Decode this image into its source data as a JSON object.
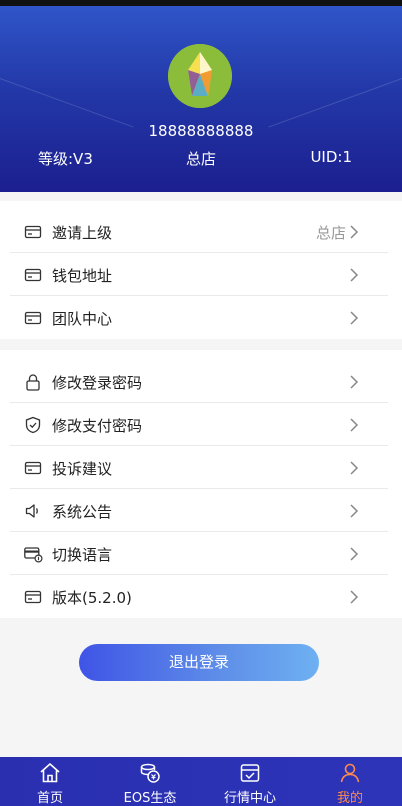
{
  "profile": {
    "phone": "18888888888",
    "level": "等级:V3",
    "store": "总店",
    "uid": "UID:1"
  },
  "menu_group_1": [
    {
      "label": "邀请上级",
      "value": "总店",
      "icon": "card-icon"
    },
    {
      "label": "钱包地址",
      "value": "",
      "icon": "card-icon"
    },
    {
      "label": "团队中心",
      "value": "",
      "icon": "card-icon"
    }
  ],
  "menu_group_2": [
    {
      "label": "修改登录密码",
      "icon": "lock-icon"
    },
    {
      "label": "修改支付密码",
      "icon": "shield-icon"
    },
    {
      "label": "投诉建议",
      "icon": "card-icon"
    },
    {
      "label": "系统公告",
      "icon": "speaker-icon"
    },
    {
      "label": "切换语言",
      "icon": "language-card-icon"
    },
    {
      "label": "版本(5.2.0)",
      "icon": "card-icon"
    }
  ],
  "logout_label": "退出登录",
  "tabbar": [
    {
      "label": "首页",
      "icon": "home-icon"
    },
    {
      "label": "EOS生态",
      "icon": "coins-icon"
    },
    {
      "label": "行情中心",
      "icon": "market-box-icon"
    },
    {
      "label": "我的",
      "icon": "user-icon"
    }
  ],
  "colors": {
    "header_top": "#2f55c8",
    "header_bottom": "#1c1f8f",
    "active_tab": "#ff8a4c",
    "tabbar_bg": "#2a2fb0"
  }
}
